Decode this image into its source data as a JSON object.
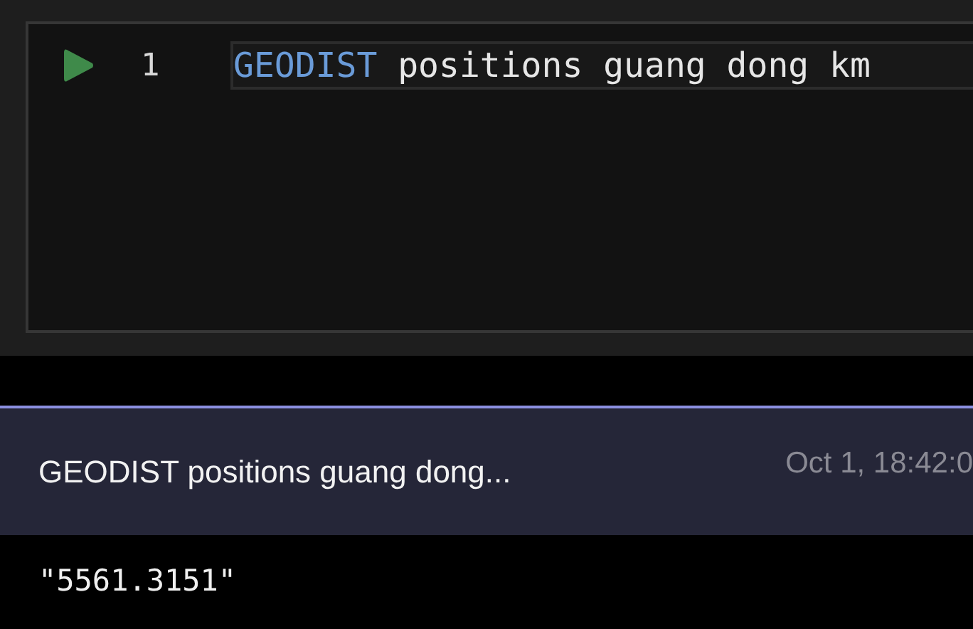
{
  "editor": {
    "lines": [
      {
        "number": "1",
        "tokens": [
          {
            "text": "GEODIST",
            "kind": "keyword"
          },
          {
            "text": " positions guang dong km",
            "kind": "plain"
          }
        ]
      }
    ]
  },
  "history": {
    "command": "GEODIST positions guang dong...",
    "time": "Oct 1, 18:42:0"
  },
  "result": {
    "value": "\"5561.3151\""
  }
}
